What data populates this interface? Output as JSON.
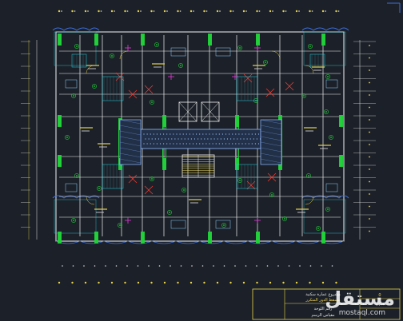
{
  "viewport": {
    "background": "#1c2129",
    "palette": {
      "wall": "#f2f2f2",
      "dim": "#e8d24a",
      "green": "#22d13a",
      "red": "#ff3b30",
      "cyan": "#27d3e6",
      "magenta": "#e23bd6",
      "blue": "#3d6fe0",
      "furniture": "#8fd0ff"
    }
  },
  "drawing": {
    "title_block": {
      "line1": "مشروع عمارة سكنية",
      "line2": "مسقط الدور المتكرر",
      "row_a": "رقم اللوحة",
      "row_b": "مقياس الرسم",
      "sheet_no": "0",
      "scale": "١:١٠٠"
    }
  },
  "watermark": {
    "brand": "مستقل",
    "site": "mostaql.com"
  }
}
